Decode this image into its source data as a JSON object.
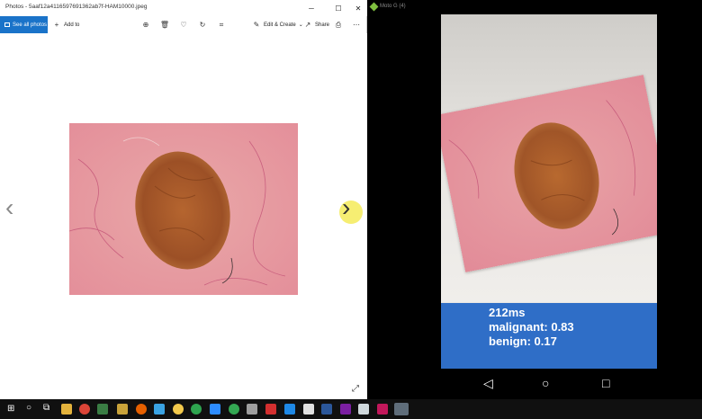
{
  "photos": {
    "title": "Photos - 5aaf12a4116597691362ab7f-HAM10000.jpeg",
    "see_all": "See all photos",
    "add_to": "Add to",
    "edit_create": "Edit & Create",
    "share": "Share"
  },
  "phone": {
    "window_title": "Moto G (4)",
    "result": {
      "time": "212ms",
      "malignant": "malignant: 0.83",
      "benign": "benign: 0.17"
    }
  },
  "icons": [
    "zoom-icon",
    "delete-icon",
    "favorite-icon",
    "rotate-icon",
    "crop-icon",
    "print-icon",
    "more-icon"
  ],
  "colors": {
    "accent": "#1a73c9",
    "result_bg": "#2f6ec7"
  }
}
